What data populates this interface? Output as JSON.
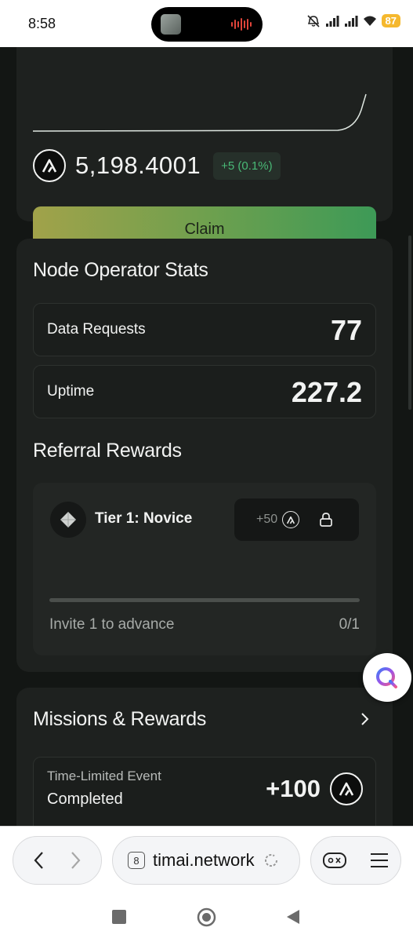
{
  "status_bar": {
    "time": "8:58",
    "battery": "87"
  },
  "balance": {
    "amount": "5,198.4001",
    "change": "+5 (0.1%)",
    "claim_label": "Claim"
  },
  "node_stats": {
    "title": "Node Operator Stats",
    "rows": [
      {
        "label": "Data Requests",
        "value": "77"
      },
      {
        "label": "Uptime",
        "value": "227.2"
      }
    ]
  },
  "referral": {
    "title": "Referral Rewards",
    "tier_name": "Tier 1: Novice",
    "reward": "+50",
    "progress_text": "Invite 1 to advance",
    "progress_count": "0/1",
    "progress_fraction": 0
  },
  "missions": {
    "title": "Missions & Rewards",
    "event_label": "Time-Limited Event",
    "event_status": "Completed",
    "event_reward": "+100"
  },
  "browser": {
    "tab_count": "8",
    "url": "timai.network"
  },
  "icons": {
    "status": [
      "mute-icon",
      "signal-icon",
      "signal-icon",
      "wifi-icon"
    ],
    "browser": [
      "back-icon",
      "forward-icon",
      "reload-icon",
      "game-icon",
      "menu-icon"
    ],
    "system_nav": [
      "recents-icon",
      "home-icon",
      "back-nav-icon"
    ]
  },
  "colors": {
    "accent_green": "#49b976",
    "claim_gradient_start": "#a1a24a",
    "claim_gradient_end": "#3d9a57",
    "battery": "#f5b82e"
  }
}
